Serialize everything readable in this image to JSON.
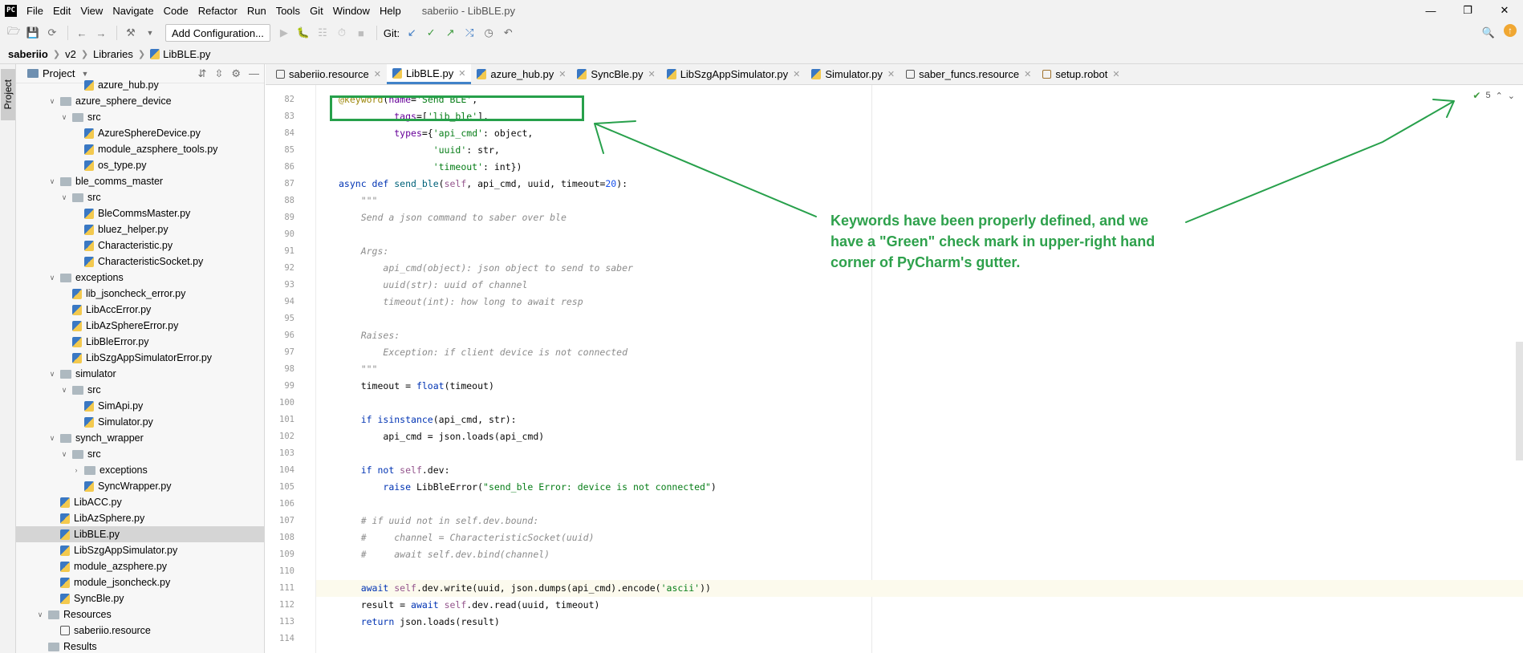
{
  "menubar": {
    "app_logo": "PC",
    "items": [
      "File",
      "Edit",
      "View",
      "Navigate",
      "Code",
      "Refactor",
      "Run",
      "Tools",
      "Git",
      "Window",
      "Help"
    ],
    "window_title": "saberiio - LibBLE.py"
  },
  "toolbar": {
    "config_label": "Add Configuration...",
    "git_label": "Git:"
  },
  "breadcrumb": [
    "saberiio",
    "v2",
    "Libraries",
    "LibBLE.py"
  ],
  "tool_stripe": {
    "project_label": "Project"
  },
  "project_panel": {
    "title": "Project",
    "rows": [
      {
        "label": "azure_hub.py",
        "indent": 5,
        "type": "file",
        "arrow": ""
      },
      {
        "label": "azure_sphere_device",
        "indent": 3,
        "type": "folder",
        "arrow": "v"
      },
      {
        "label": "src",
        "indent": 4,
        "type": "folder",
        "arrow": "v"
      },
      {
        "label": "AzureSphereDevice.py",
        "indent": 5,
        "type": "file",
        "arrow": ""
      },
      {
        "label": "module_azsphere_tools.py",
        "indent": 5,
        "type": "file",
        "arrow": ""
      },
      {
        "label": "os_type.py",
        "indent": 5,
        "type": "file",
        "arrow": ""
      },
      {
        "label": "ble_comms_master",
        "indent": 3,
        "type": "folder",
        "arrow": "v"
      },
      {
        "label": "src",
        "indent": 4,
        "type": "folder",
        "arrow": "v"
      },
      {
        "label": "BleCommsMaster.py",
        "indent": 5,
        "type": "file",
        "arrow": ""
      },
      {
        "label": "bluez_helper.py",
        "indent": 5,
        "type": "file",
        "arrow": ""
      },
      {
        "label": "Characteristic.py",
        "indent": 5,
        "type": "file",
        "arrow": ""
      },
      {
        "label": "CharacteristicSocket.py",
        "indent": 5,
        "type": "file",
        "arrow": ""
      },
      {
        "label": "exceptions",
        "indent": 3,
        "type": "folder",
        "arrow": "v"
      },
      {
        "label": "lib_jsoncheck_error.py",
        "indent": 4,
        "type": "file",
        "arrow": ""
      },
      {
        "label": "LibAccError.py",
        "indent": 4,
        "type": "file",
        "arrow": ""
      },
      {
        "label": "LibAzSphereError.py",
        "indent": 4,
        "type": "file",
        "arrow": ""
      },
      {
        "label": "LibBleError.py",
        "indent": 4,
        "type": "file",
        "arrow": ""
      },
      {
        "label": "LibSzgAppSimulatorError.py",
        "indent": 4,
        "type": "file",
        "arrow": ""
      },
      {
        "label": "simulator",
        "indent": 3,
        "type": "folder",
        "arrow": "v"
      },
      {
        "label": "src",
        "indent": 4,
        "type": "folder",
        "arrow": "v"
      },
      {
        "label": "SimApi.py",
        "indent": 5,
        "type": "file",
        "arrow": ""
      },
      {
        "label": "Simulator.py",
        "indent": 5,
        "type": "file",
        "arrow": ""
      },
      {
        "label": "synch_wrapper",
        "indent": 3,
        "type": "folder",
        "arrow": "v"
      },
      {
        "label": "src",
        "indent": 4,
        "type": "folder",
        "arrow": "v"
      },
      {
        "label": "exceptions",
        "indent": 5,
        "type": "folder",
        "arrow": ">"
      },
      {
        "label": "SyncWrapper.py",
        "indent": 5,
        "type": "file",
        "arrow": ""
      },
      {
        "label": "LibACC.py",
        "indent": 3,
        "type": "file",
        "arrow": ""
      },
      {
        "label": "LibAzSphere.py",
        "indent": 3,
        "type": "file",
        "arrow": ""
      },
      {
        "label": "LibBLE.py",
        "indent": 3,
        "type": "file",
        "arrow": "",
        "selected": true
      },
      {
        "label": "LibSzgAppSimulator.py",
        "indent": 3,
        "type": "file",
        "arrow": ""
      },
      {
        "label": "module_azsphere.py",
        "indent": 3,
        "type": "file",
        "arrow": ""
      },
      {
        "label": "module_jsoncheck.py",
        "indent": 3,
        "type": "file",
        "arrow": ""
      },
      {
        "label": "SyncBle.py",
        "indent": 3,
        "type": "file",
        "arrow": ""
      },
      {
        "label": "Resources",
        "indent": 2,
        "type": "folder",
        "arrow": "v"
      },
      {
        "label": "saberiio.resource",
        "indent": 3,
        "type": "resource",
        "arrow": ""
      },
      {
        "label": "Results",
        "indent": 2,
        "type": "folder",
        "arrow": ""
      }
    ]
  },
  "tabs": [
    {
      "label": "saberiio.resource",
      "icon": "resource",
      "active": false
    },
    {
      "label": "LibBLE.py",
      "icon": "python",
      "active": true
    },
    {
      "label": "azure_hub.py",
      "icon": "python",
      "active": false
    },
    {
      "label": "SyncBle.py",
      "icon": "python",
      "active": false
    },
    {
      "label": "LibSzgAppSimulator.py",
      "icon": "python",
      "active": false
    },
    {
      "label": "Simulator.py",
      "icon": "python",
      "active": false
    },
    {
      "label": "saber_funcs.resource",
      "icon": "resource",
      "active": false
    },
    {
      "label": "setup.robot",
      "icon": "robot",
      "active": false
    }
  ],
  "editor": {
    "first_line_number": 81,
    "inspection_count": "5",
    "current_line": 111,
    "lines": [
      [],
      [
        [
          "dec",
          "@keyword"
        ],
        [
          "",
          "("
        ],
        [
          "param",
          "name"
        ],
        [
          "",
          "="
        ],
        [
          "str",
          "'Send BLE'"
        ],
        [
          "",
          ","
        ]
      ],
      [
        [
          "",
          "          "
        ],
        [
          "param",
          "tags"
        ],
        [
          "",
          "=["
        ],
        [
          "str",
          "'lib_ble'"
        ],
        [
          "",
          "],"
        ]
      ],
      [
        [
          "",
          "          "
        ],
        [
          "param",
          "types"
        ],
        [
          "",
          "={"
        ],
        [
          "str",
          "'api_cmd'"
        ],
        [
          "",
          ": object,"
        ]
      ],
      [
        [
          "",
          "                 "
        ],
        [
          "str",
          "'uuid'"
        ],
        [
          "",
          ": str,"
        ]
      ],
      [
        [
          "",
          "                 "
        ],
        [
          "str",
          "'timeout'"
        ],
        [
          "",
          ": int})"
        ]
      ],
      [
        [
          "kw",
          "async def "
        ],
        [
          "fn",
          "send_ble"
        ],
        [
          "",
          "("
        ],
        [
          "self",
          "self"
        ],
        [
          "",
          ", api_cmd, uuid, timeout="
        ],
        [
          "num",
          "20"
        ],
        [
          "",
          "):"
        ]
      ],
      [
        [
          "",
          "    "
        ],
        [
          "cmt",
          "\"\"\""
        ]
      ],
      [
        [
          "",
          "    "
        ],
        [
          "cmt",
          "Send a json command to saber over ble"
        ]
      ],
      [],
      [
        [
          "",
          "    "
        ],
        [
          "cmt",
          "Args:"
        ]
      ],
      [
        [
          "",
          "        "
        ],
        [
          "cmt",
          "api_cmd(object): json object to send to saber"
        ]
      ],
      [
        [
          "",
          "        "
        ],
        [
          "cmt",
          "uuid(str): uuid of channel"
        ]
      ],
      [
        [
          "",
          "        "
        ],
        [
          "cmt",
          "timeout(int): how long to await resp"
        ]
      ],
      [],
      [
        [
          "",
          "    "
        ],
        [
          "cmt",
          "Raises:"
        ]
      ],
      [
        [
          "",
          "        "
        ],
        [
          "cmt",
          "Exception: if client device is not connected"
        ]
      ],
      [
        [
          "",
          "    "
        ],
        [
          "cmt",
          "\"\"\""
        ]
      ],
      [
        [
          "",
          "    timeout = "
        ],
        [
          "kw",
          "float"
        ],
        [
          "",
          "(timeout)"
        ]
      ],
      [],
      [
        [
          "",
          "    "
        ],
        [
          "kw",
          "if "
        ],
        [
          "kw",
          "isinstance"
        ],
        [
          "",
          "(api_cmd, str):"
        ]
      ],
      [
        [
          "",
          "        api_cmd = json.loads(api_cmd)"
        ]
      ],
      [],
      [
        [
          "",
          "    "
        ],
        [
          "kw",
          "if not "
        ],
        [
          "self",
          "self"
        ],
        [
          "",
          ".dev:"
        ]
      ],
      [
        [
          "",
          "        "
        ],
        [
          "kw",
          "raise "
        ],
        [
          "",
          "LibBleError("
        ],
        [
          "str",
          "\"send_ble Error: device is not connected\""
        ],
        [
          "",
          ")"
        ]
      ],
      [],
      [
        [
          "",
          "    "
        ],
        [
          "cmt",
          "# if uuid not in self.dev.bound:"
        ]
      ],
      [
        [
          "",
          "    "
        ],
        [
          "cmt",
          "#     channel = CharacteristicSocket(uuid)"
        ]
      ],
      [
        [
          "",
          "    "
        ],
        [
          "cmt",
          "#     await self.dev.bind(channel)"
        ]
      ],
      [],
      [
        [
          "",
          "    "
        ],
        [
          "kw",
          "await "
        ],
        [
          "self",
          "self"
        ],
        [
          "",
          ".dev.write(uuid, json.dumps(api_cmd).encode("
        ],
        [
          "str",
          "'ascii'"
        ],
        [
          "",
          "))"
        ]
      ],
      [
        [
          "",
          "    result = "
        ],
        [
          "kw",
          "await "
        ],
        [
          "self",
          "self"
        ],
        [
          "",
          ".dev.read(uuid, timeout)"
        ]
      ],
      [
        [
          "",
          "    "
        ],
        [
          "kw",
          "return "
        ],
        [
          "",
          "json.loads(result)"
        ]
      ],
      []
    ]
  },
  "annotation": {
    "text": "Keywords have been properly defined, and we have a \"Green\" check mark in upper-right hand corner of PyCharm's gutter.",
    "color": "#2ea14c"
  }
}
